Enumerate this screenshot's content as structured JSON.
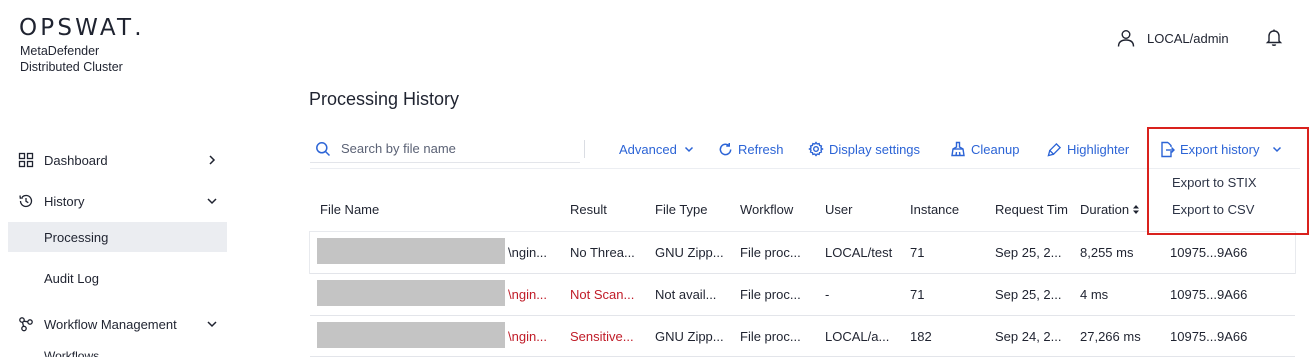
{
  "brand": {
    "logo": "OPSWAT",
    "logo_dot": ".",
    "product_line1": "MetaDefender",
    "product_line2": "Distributed Cluster"
  },
  "sidebar": {
    "items": [
      {
        "label": "Dashboard",
        "icon": "dashboard-grid-icon",
        "expanded": false
      },
      {
        "label": "History",
        "icon": "history-clock-icon",
        "expanded": true
      },
      {
        "label": "Workflow Management",
        "icon": "workflow-icon",
        "expanded": true
      }
    ],
    "history_children": [
      "Processing",
      "Audit Log"
    ],
    "active_child": "Processing",
    "workflow_child_cut": "Workflows"
  },
  "header": {
    "username": "LOCAL/admin"
  },
  "page": {
    "title": "Processing History"
  },
  "toolbar": {
    "search_placeholder": "Search by file name",
    "advanced": "Advanced",
    "refresh": "Refresh",
    "display_settings": "Display settings",
    "cleanup": "Cleanup",
    "highlighter": "Highlighter",
    "export_history": "Export history",
    "accent": "#2c64d6"
  },
  "export_menu": {
    "items": [
      "Export to STIX",
      "Export to CSV"
    ],
    "highlight_color": "#d9211d"
  },
  "table": {
    "columns": [
      "File Name",
      "Result",
      "File Type",
      "Workflow",
      "User",
      "Instance",
      "Request Tim",
      "Duration"
    ],
    "rows": [
      {
        "file_name": "\\ngin...",
        "result": "No Threa...",
        "result_color": "#1f2330",
        "file_type": "GNU Zipp...",
        "workflow": "File proc...",
        "user": "LOCAL/test",
        "instance": "71",
        "request_time": "Sep 25, 2...",
        "duration": "8,255 ms",
        "id": "10975...9A66"
      },
      {
        "file_name": "\\ngin...",
        "result": "Not Scan...",
        "result_color": "#c01c28",
        "file_type": "Not avail...",
        "workflow": "File proc...",
        "user": "-",
        "instance": "71",
        "request_time": "Sep 25, 2...",
        "duration": "4 ms",
        "id": "10975...9A66"
      },
      {
        "file_name": "\\ngin...",
        "result": "Sensitive...",
        "result_color": "#c01c28",
        "file_type": "GNU Zipp...",
        "workflow": "File proc...",
        "user": "LOCAL/a...",
        "instance": "182",
        "request_time": "Sep 24, 2...",
        "duration": "27,266 ms",
        "id": "10975...9A66"
      }
    ]
  }
}
